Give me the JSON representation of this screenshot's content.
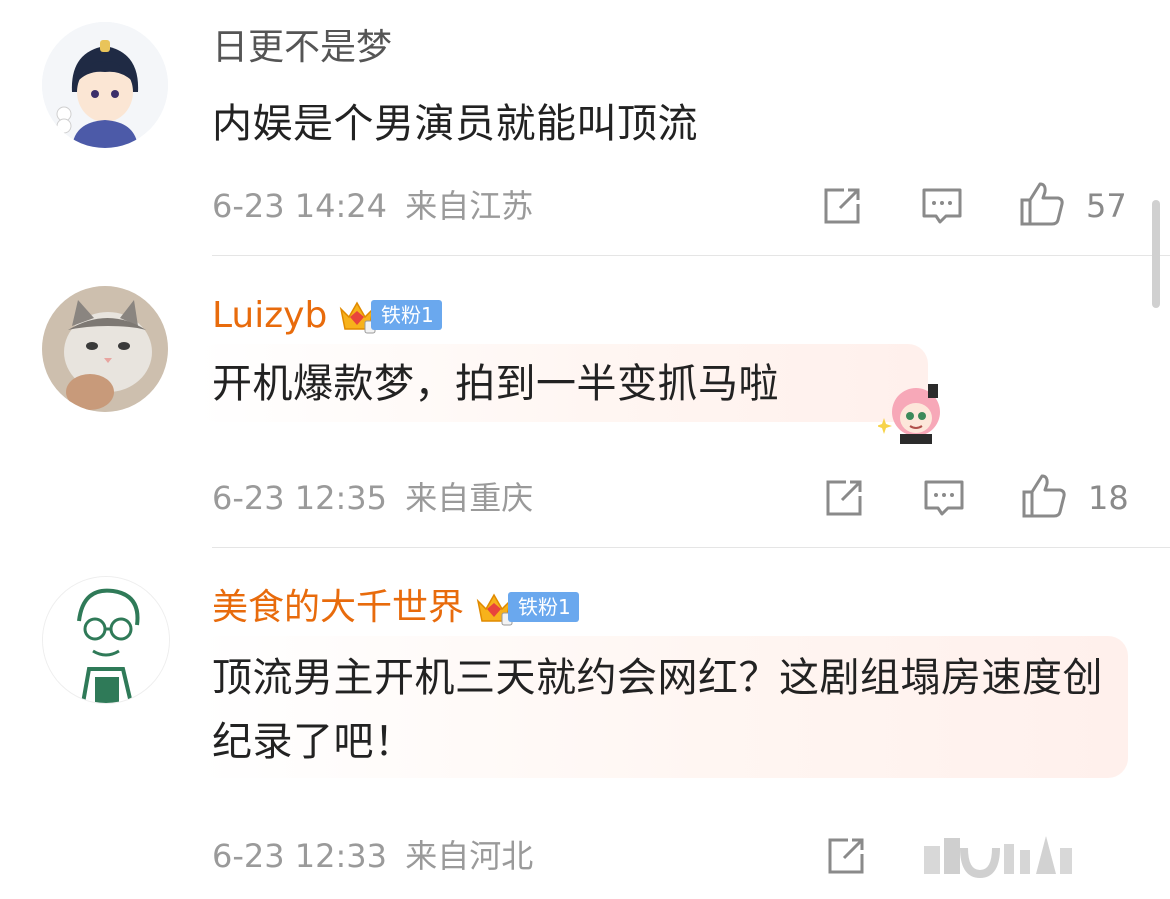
{
  "comments": [
    {
      "username": "日更不是梦",
      "text": "内娱是个男演员就能叫顶流",
      "time": "6-23 14:24",
      "location": "来自江苏",
      "likes": "57"
    },
    {
      "username": "Luizyb",
      "badge": "铁粉1",
      "text": "开机爆款梦，拍到一半变抓马啦",
      "time": "6-23 12:35",
      "location": "来自重庆",
      "likes": "18"
    },
    {
      "username": "美食的大千世界",
      "badge": "铁粉1",
      "text": "顶流男主开机三天就约会网红？这剧组塌房速度创纪录了吧！",
      "time": "6-23 12:33",
      "location": "来自河北"
    }
  ],
  "colors": {
    "vip_name": "#e86b0c",
    "fan_badge": "#6aa8ee",
    "meta_text": "#9a9a9a",
    "body_text": "#222222"
  },
  "icons": {
    "repost": "repost-icon",
    "comment": "comment-icon",
    "like": "thumbs-up-icon",
    "crown": "crown-icon"
  }
}
